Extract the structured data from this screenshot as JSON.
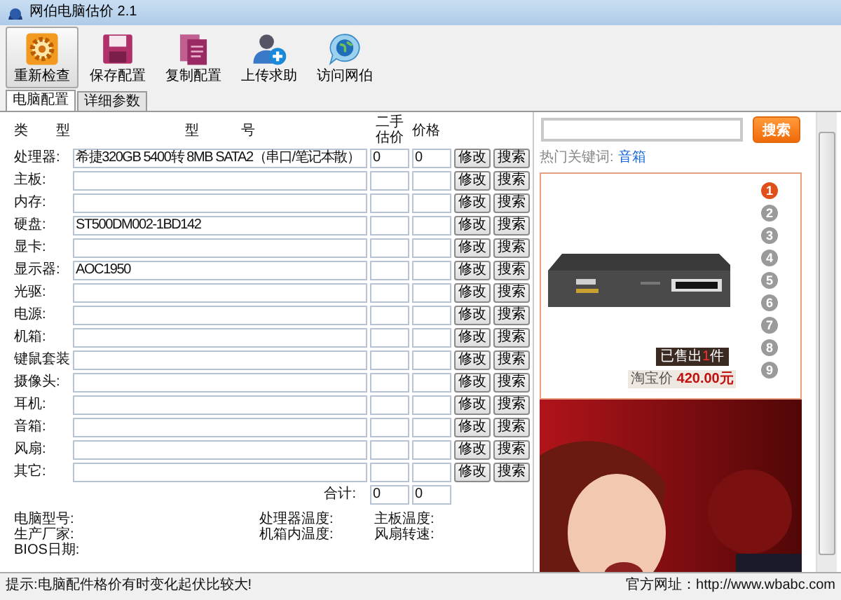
{
  "window": {
    "title": "网伯电脑估价 2.1"
  },
  "toolbar": [
    {
      "label": "重新检查",
      "selected": true
    },
    {
      "label": "保存配置",
      "selected": false
    },
    {
      "label": "复制配置",
      "selected": false
    },
    {
      "label": "上传求助",
      "selected": false
    },
    {
      "label": "访问网伯",
      "selected": false
    }
  ],
  "tabs": [
    {
      "label": "电脑配置",
      "selected": true
    },
    {
      "label": "详细参数",
      "selected": false
    }
  ],
  "table": {
    "columns": [
      "类　　型",
      "型　　　号",
      "二手估价",
      "价格"
    ],
    "rows": [
      {
        "label": "处理器:",
        "model": "希捷320GB 5400转 8MB SATA2（串口/笔记本散）",
        "used_price": "0",
        "price": "0",
        "buttons": [
          "修改",
          "搜索"
        ]
      },
      {
        "label": "主板:",
        "buttons": [
          "修改",
          "搜索"
        ]
      },
      {
        "label": "内存:",
        "buttons": [
          "修改",
          "搜索"
        ]
      },
      {
        "label": "硬盘:",
        "model": "ST500DM002-1BD142",
        "buttons": [
          "修改",
          "搜索"
        ]
      },
      {
        "label": "显卡:",
        "buttons": [
          "修改",
          "搜索"
        ]
      },
      {
        "label": "显示器:",
        "model": "AOC1950",
        "buttons": [
          "修改",
          "搜索"
        ]
      },
      {
        "label": "光驱:",
        "buttons": [
          "修改",
          "搜索"
        ]
      },
      {
        "label": "电源:",
        "buttons": [
          "修改",
          "搜索"
        ]
      },
      {
        "label": "机箱:",
        "buttons": [
          "修改",
          "搜索"
        ]
      },
      {
        "label": "键鼠套装",
        "buttons": [
          "修改",
          "搜索"
        ]
      },
      {
        "label": "摄像头:",
        "buttons": [
          "修改",
          "搜索"
        ]
      },
      {
        "label": "耳机:",
        "buttons": [
          "修改",
          "搜索"
        ]
      },
      {
        "label": "音箱:",
        "buttons": [
          "修改",
          "搜索"
        ]
      },
      {
        "label": "风扇:",
        "buttons": [
          "修改",
          "搜索"
        ]
      },
      {
        "label": "其它:",
        "buttons": [
          "修改",
          "搜索"
        ]
      }
    ],
    "total": {
      "label": "合计:",
      "used_price": "0",
      "price": "0"
    }
  },
  "info": [
    [
      "电脑型号:",
      "生产厂家:",
      "BIOS日期:"
    ],
    [
      "处理器温度:",
      "机箱内温度:"
    ],
    [
      "主板温度:",
      "风扇转速:"
    ]
  ],
  "sidebar": {
    "search_button": "搜索",
    "hot_label": "热门关键词:",
    "hot_link": "音箱",
    "product": {
      "sold_prefix": "已售出",
      "sold_count": "1",
      "sold_suffix": "件",
      "price_label": "淘宝价",
      "price": "420.00元",
      "pages": [
        {
          "label": "1",
          "selected": true
        },
        {
          "label": "2",
          "selected": false
        },
        {
          "label": "3",
          "selected": false
        },
        {
          "label": "4",
          "selected": false
        },
        {
          "label": "5",
          "selected": false
        },
        {
          "label": "6",
          "selected": false
        },
        {
          "label": "7",
          "selected": false
        },
        {
          "label": "8",
          "selected": false
        },
        {
          "label": "9",
          "selected": false
        }
      ]
    }
  },
  "status_bar": {
    "hint": "提示:电脑配件格价有时变化起伏比较大!",
    "site": "官方网址：http://www.wbabc.com"
  }
}
